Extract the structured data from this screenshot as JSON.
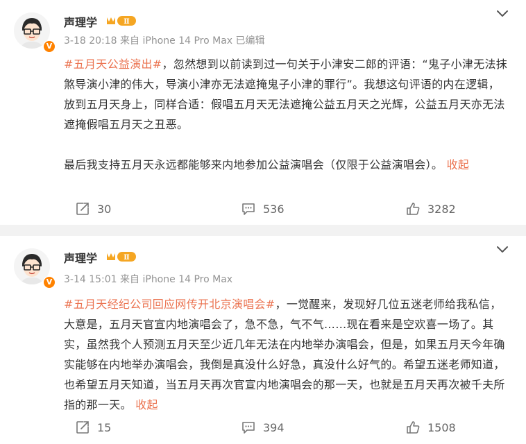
{
  "posts": [
    {
      "username": "声理学",
      "level_badge": "Ⅱ",
      "verified_badge": "V",
      "date": "3-18 20:18",
      "source": "来自 iPhone 14 Pro Max",
      "edited": "已编辑",
      "hashtag": "#五月天公益演出#",
      "text_1": "，忽然想到以前读到过一句关于小津安二郎的评语：“鬼子小津无法抹煞导演小津的伟大，导演小津亦无法遮掩鬼子小津的罪行”。我想这句评语的内在逻辑，放到五月天身上，同样合适：假唱五月天无法遮掩公益五月天之光辉，公益五月天亦无法遮掩假唱五月天之丑恶。",
      "text_2": "最后我支持五月天永远都能够来内地参加公益演唱会（仅限于公益演唱会）。",
      "collapse_label": "收起",
      "reposts": "30",
      "comments": "536",
      "likes": "3282"
    },
    {
      "username": "声理学",
      "level_badge": "Ⅱ",
      "verified_badge": "V",
      "date": "3-14 15:01",
      "source": "来自 iPhone 14 Pro Max",
      "hashtag": "#五月天经纪公司回应网传开北京演唱会#",
      "text_1": "，一觉醒来，发现好几位五迷老师给我私信，大意是，五月天官宣内地演唱会了，急不急，气不气……现在看来是空欢喜一场了。其实，虽然我个人预测五月天至少近几年无法在内地举办演唱会，但是，如果五月天今年确实能够在内地举办演唱会，我倒是真没什么好急，真没什么好气的。希望五迷老师知道，也希望五月天知道，当五月天再次官宣内地演唱会的那一天，也就是五月天再次被千夫所指的那一天。",
      "collapse_label": "收起",
      "reposts": "15",
      "comments": "394",
      "likes": "1508"
    }
  ],
  "colors": {
    "accent": "#eb7350",
    "meta": "#939393",
    "verified": "#ff8200",
    "divider": "#f2f2f2"
  },
  "icons": [
    "avatar",
    "level-badge-icon",
    "verified-badge-icon",
    "chevron-down-icon",
    "repost-icon",
    "comment-icon",
    "like-icon"
  ]
}
